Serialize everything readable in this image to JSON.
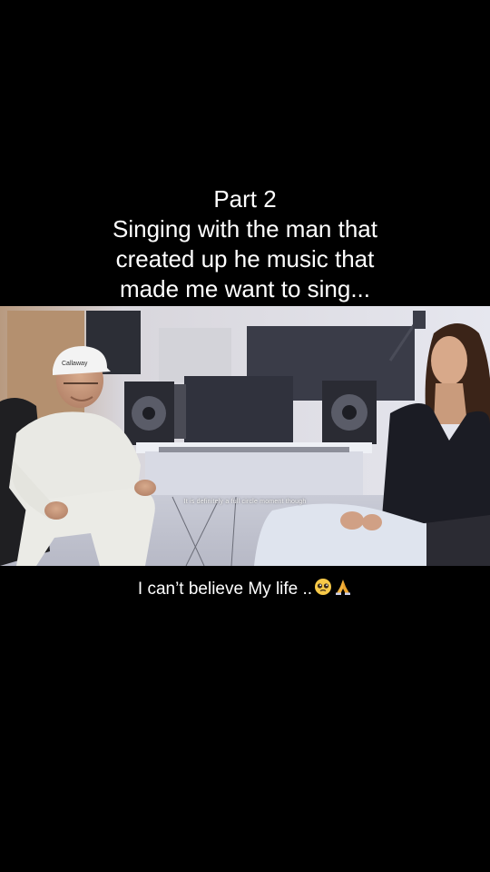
{
  "caption": {
    "lines": [
      "Part 2",
      "Singing with the man that",
      "created up he music that",
      "made me want to sing..."
    ],
    "bottom_text": "I can’t believe My life ..",
    "bottom_emojis": [
      "pleading-face-emoji",
      "folded-hands-emoji"
    ]
  },
  "video": {
    "subtitle": "It is definitely a full circle moment though",
    "cap_text": "Callaway"
  }
}
